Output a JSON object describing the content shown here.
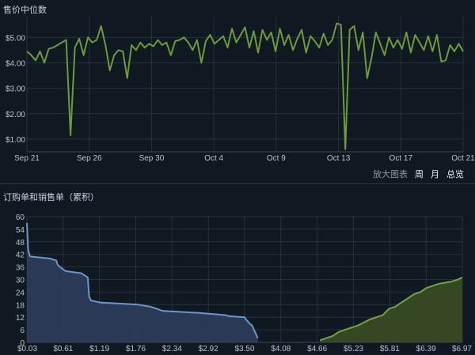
{
  "charts_ui": {
    "price_title": "售价中位数",
    "orders_title": "订购单和销售单（累积）",
    "zoom_label": "放大图表",
    "zoom_week": "周",
    "zoom_month": "月",
    "zoom_all": "总览"
  },
  "colors": {
    "background": "#101822",
    "grid": "#24323f",
    "price_line": "#6d9a3e",
    "buy_line": "#6d96c9",
    "buy_fill": "#2d3d5c",
    "sell_line": "#77a33f",
    "sell_fill": "#3a4d24"
  },
  "chart_data": [
    {
      "type": "line",
      "title": "售价中位数",
      "x_ticks": [
        "Sep 21",
        "Sep 26",
        "Sep 30",
        "Oct 4",
        "Oct 9",
        "Oct 13",
        "Oct 17",
        "Oct 21"
      ],
      "y_ticks": [
        "$1.00",
        "$2.00",
        "$3.00",
        "$4.00",
        "$5.00"
      ],
      "xlim": [
        0,
        30
      ],
      "ylim": [
        0.5,
        5.85
      ],
      "grid": true,
      "series": [
        {
          "x": [
            0,
            0.3,
            0.6,
            0.9,
            1.2,
            1.5,
            1.8,
            2.1,
            2.4,
            2.7,
            3.0,
            3.3,
            3.6,
            3.9,
            4.2,
            4.5,
            4.8,
            5.1,
            5.4,
            5.7,
            6.0,
            6.3,
            6.6,
            6.9,
            7.2,
            7.5,
            7.8,
            8.1,
            8.4,
            8.7,
            9.0,
            9.3,
            9.6,
            9.9,
            10.2,
            10.5,
            10.8,
            11.1,
            11.4,
            11.7,
            12.0,
            12.3,
            12.6,
            12.9,
            13.2,
            13.5,
            13.8,
            14.1,
            14.4,
            14.7,
            15.0,
            15.3,
            15.6,
            15.9,
            16.2,
            16.5,
            16.8,
            17.1,
            17.4,
            17.7,
            18.0,
            18.3,
            18.6,
            18.9,
            19.2,
            19.5,
            19.8,
            20.1,
            20.4,
            20.7,
            21.0,
            21.3,
            21.6,
            21.9,
            22.2,
            22.5,
            22.8,
            23.1,
            23.4,
            23.7,
            24.0,
            24.3,
            24.6,
            24.9,
            25.2,
            25.5,
            25.8,
            26.1,
            26.4,
            26.7,
            27.0,
            27.3,
            27.6,
            27.9,
            28.2,
            28.5,
            28.8,
            29.1,
            29.4,
            29.7,
            30.0
          ],
          "values": [
            4.45,
            4.3,
            4.1,
            4.45,
            4.0,
            4.55,
            4.6,
            4.7,
            4.8,
            4.9,
            1.15,
            4.6,
            4.95,
            4.3,
            5.0,
            4.8,
            4.9,
            5.45,
            4.7,
            3.7,
            4.3,
            4.5,
            4.45,
            3.4,
            4.7,
            4.5,
            4.8,
            4.6,
            4.75,
            4.65,
            4.9,
            4.7,
            4.8,
            4.3,
            4.85,
            4.9,
            5.0,
            4.8,
            4.5,
            4.9,
            4.0,
            4.85,
            5.1,
            4.75,
            4.9,
            5.05,
            4.6,
            5.35,
            4.8,
            5.1,
            5.4,
            4.6,
            5.25,
            4.4,
            5.3,
            4.9,
            5.2,
            4.45,
            5.35,
            4.7,
            5.1,
            4.5,
            4.95,
            5.3,
            4.4,
            5.05,
            4.85,
            4.6,
            5.15,
            4.7,
            4.9,
            5.55,
            5.5,
            0.6,
            5.3,
            5.45,
            4.5,
            5.2,
            3.4,
            4.2,
            5.2,
            4.75,
            4.3,
            5.0,
            4.6,
            4.9,
            4.55,
            5.2,
            4.4,
            5.1,
            4.8,
            4.5,
            5.05,
            4.45,
            5.1,
            4.05,
            4.1,
            4.7,
            4.45,
            4.75,
            4.45
          ]
        }
      ]
    },
    {
      "type": "area",
      "title": "订购单和销售单（累积）",
      "x_ticks": [
        "$0.03",
        "$0.61",
        "$1.19",
        "$1.76",
        "$2.34",
        "$2.92",
        "$3.50",
        "$4.08",
        "$4.66",
        "$5.23",
        "$5.81",
        "$6.39",
        "$6.97"
      ],
      "y_ticks": [
        "0",
        "6",
        "12",
        "18",
        "24",
        "30",
        "36",
        "42",
        "48",
        "54",
        "60"
      ],
      "xlim": [
        0.03,
        6.97
      ],
      "ylim": [
        0,
        60
      ],
      "grid": true,
      "series": [
        {
          "name": "buy",
          "x": [
            0.03,
            0.05,
            0.08,
            0.4,
            0.5,
            0.52,
            0.6,
            0.65,
            0.9,
            1.0,
            1.02,
            1.05,
            1.2,
            1.8,
            2.0,
            2.1,
            2.2,
            2.8,
            3.0,
            3.2,
            3.25,
            3.5,
            3.52,
            3.58,
            3.62,
            3.65,
            3.68,
            3.71
          ],
          "values": [
            57,
            44,
            41,
            40,
            39,
            37,
            35,
            34,
            33,
            31,
            22,
            20,
            19,
            18,
            17,
            16,
            15,
            14,
            13.5,
            13,
            12.5,
            12,
            11,
            9,
            8,
            6,
            4,
            2
          ]
        },
        {
          "name": "sell",
          "x": [
            4.7,
            4.8,
            4.9,
            5.0,
            5.1,
            5.2,
            5.3,
            5.5,
            5.6,
            5.7,
            5.8,
            5.9,
            6.0,
            6.1,
            6.2,
            6.3,
            6.4,
            6.5,
            6.6,
            6.7,
            6.8,
            6.9,
            6.97
          ],
          "values": [
            1,
            2,
            3,
            5,
            6,
            7,
            8,
            11,
            12,
            13,
            16,
            17,
            19,
            21,
            23,
            24,
            26,
            27,
            28,
            28.5,
            29,
            30,
            31
          ]
        }
      ]
    }
  ]
}
